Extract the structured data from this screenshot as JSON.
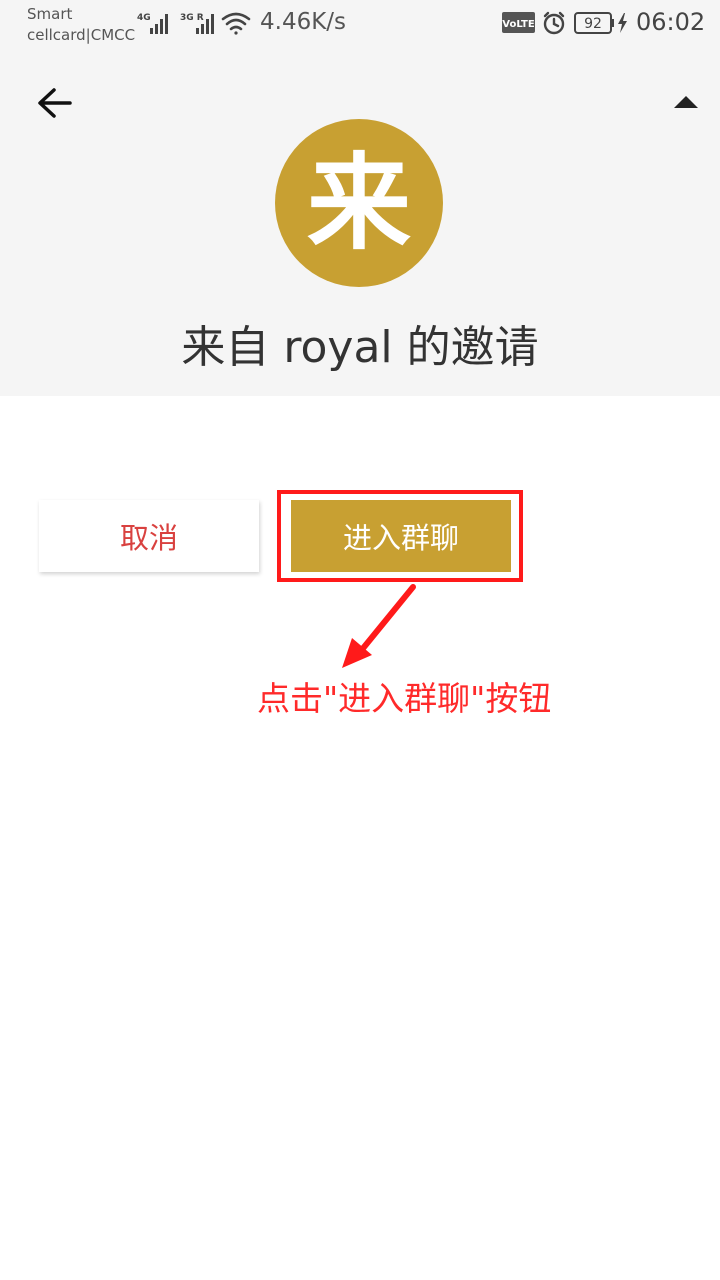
{
  "status_bar": {
    "carrier_line1": "Smart",
    "carrier_line2": "cellcard|CMCC",
    "net1_label": "4G",
    "net2_label": "3G R",
    "net_speed": "4.46K/s",
    "volte_label": "VoLTE",
    "battery_level": "92",
    "time": "06:02"
  },
  "header": {
    "avatar_char": "来",
    "invite_title": "来自 royal 的邀请"
  },
  "actions": {
    "cancel_label": "取消",
    "enter_label": "进入群聊"
  },
  "annotation": {
    "text": "点击\"进入群聊\"按钮",
    "color": "#ff2a2a"
  },
  "colors": {
    "accent": "#c8a032",
    "cancel_text": "#d9413f",
    "background_top": "#f5f5f5"
  }
}
